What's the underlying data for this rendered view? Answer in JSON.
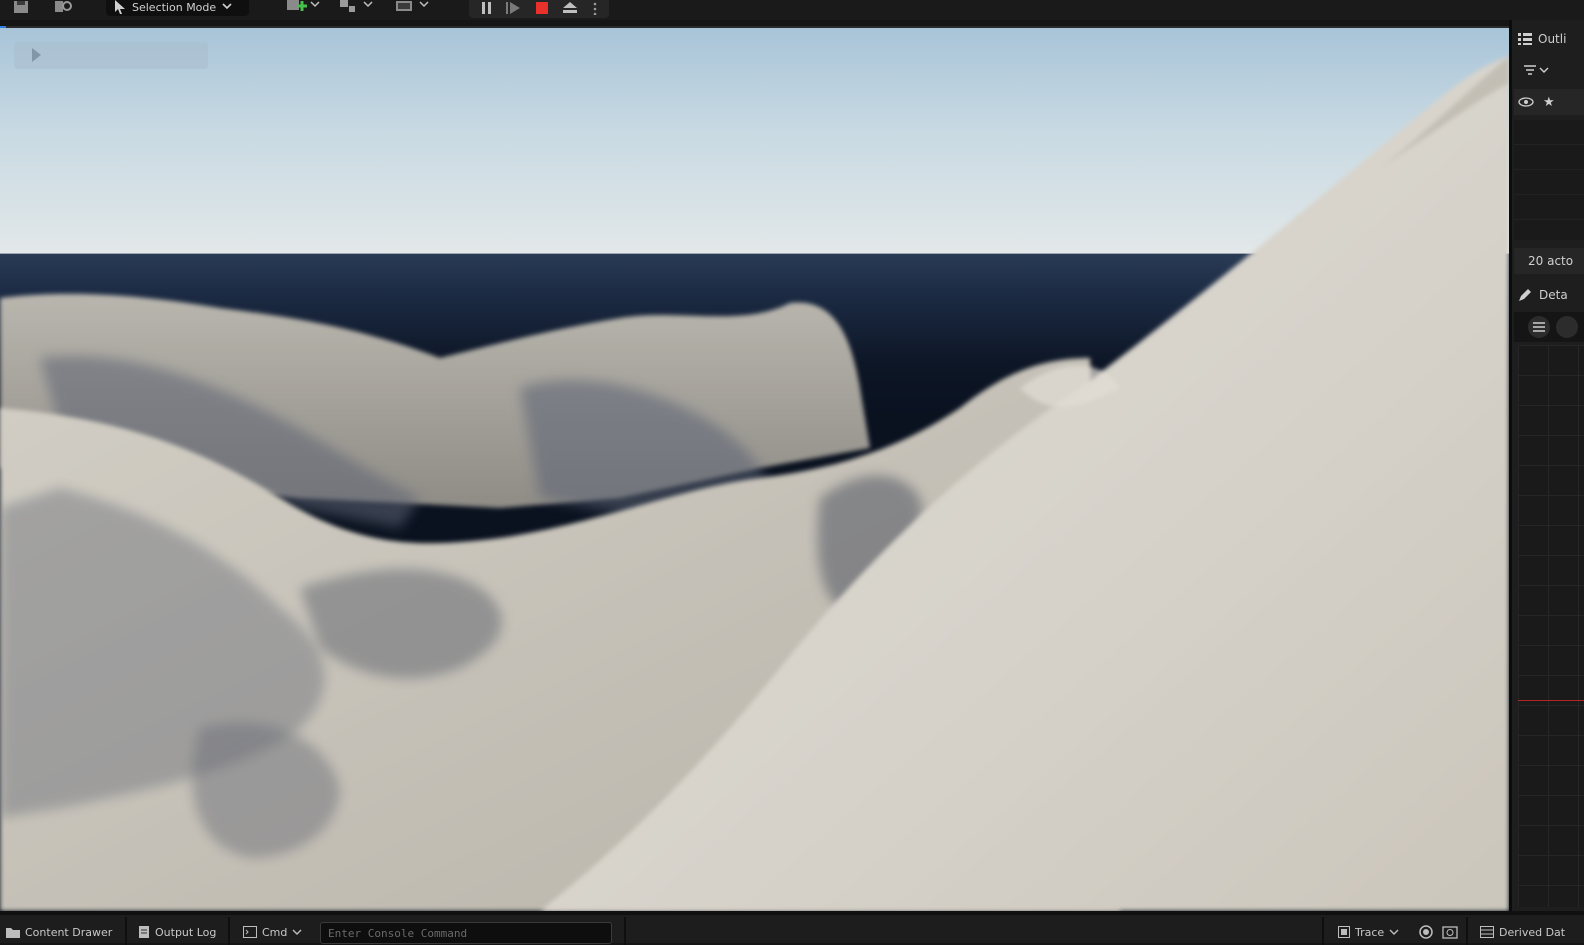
{
  "toolbar": {
    "selection_mode_label": "Selection Mode",
    "play_stop_color": "#e8312b"
  },
  "viewport": {
    "scene": "rocky-terrain",
    "sky_color": "#c9dae3",
    "ground_color": "#cfcac0"
  },
  "outliner": {
    "title": "Outli",
    "actor_count": "20 acto"
  },
  "details": {
    "title": "Deta"
  },
  "bottom_bar": {
    "content_drawer_label": "Content Drawer",
    "output_log_label": "Output Log",
    "cmd_label": "Cmd",
    "console_placeholder": "Enter Console Command",
    "trace_label": "Trace",
    "derived_data_label": "Derived Dat"
  }
}
